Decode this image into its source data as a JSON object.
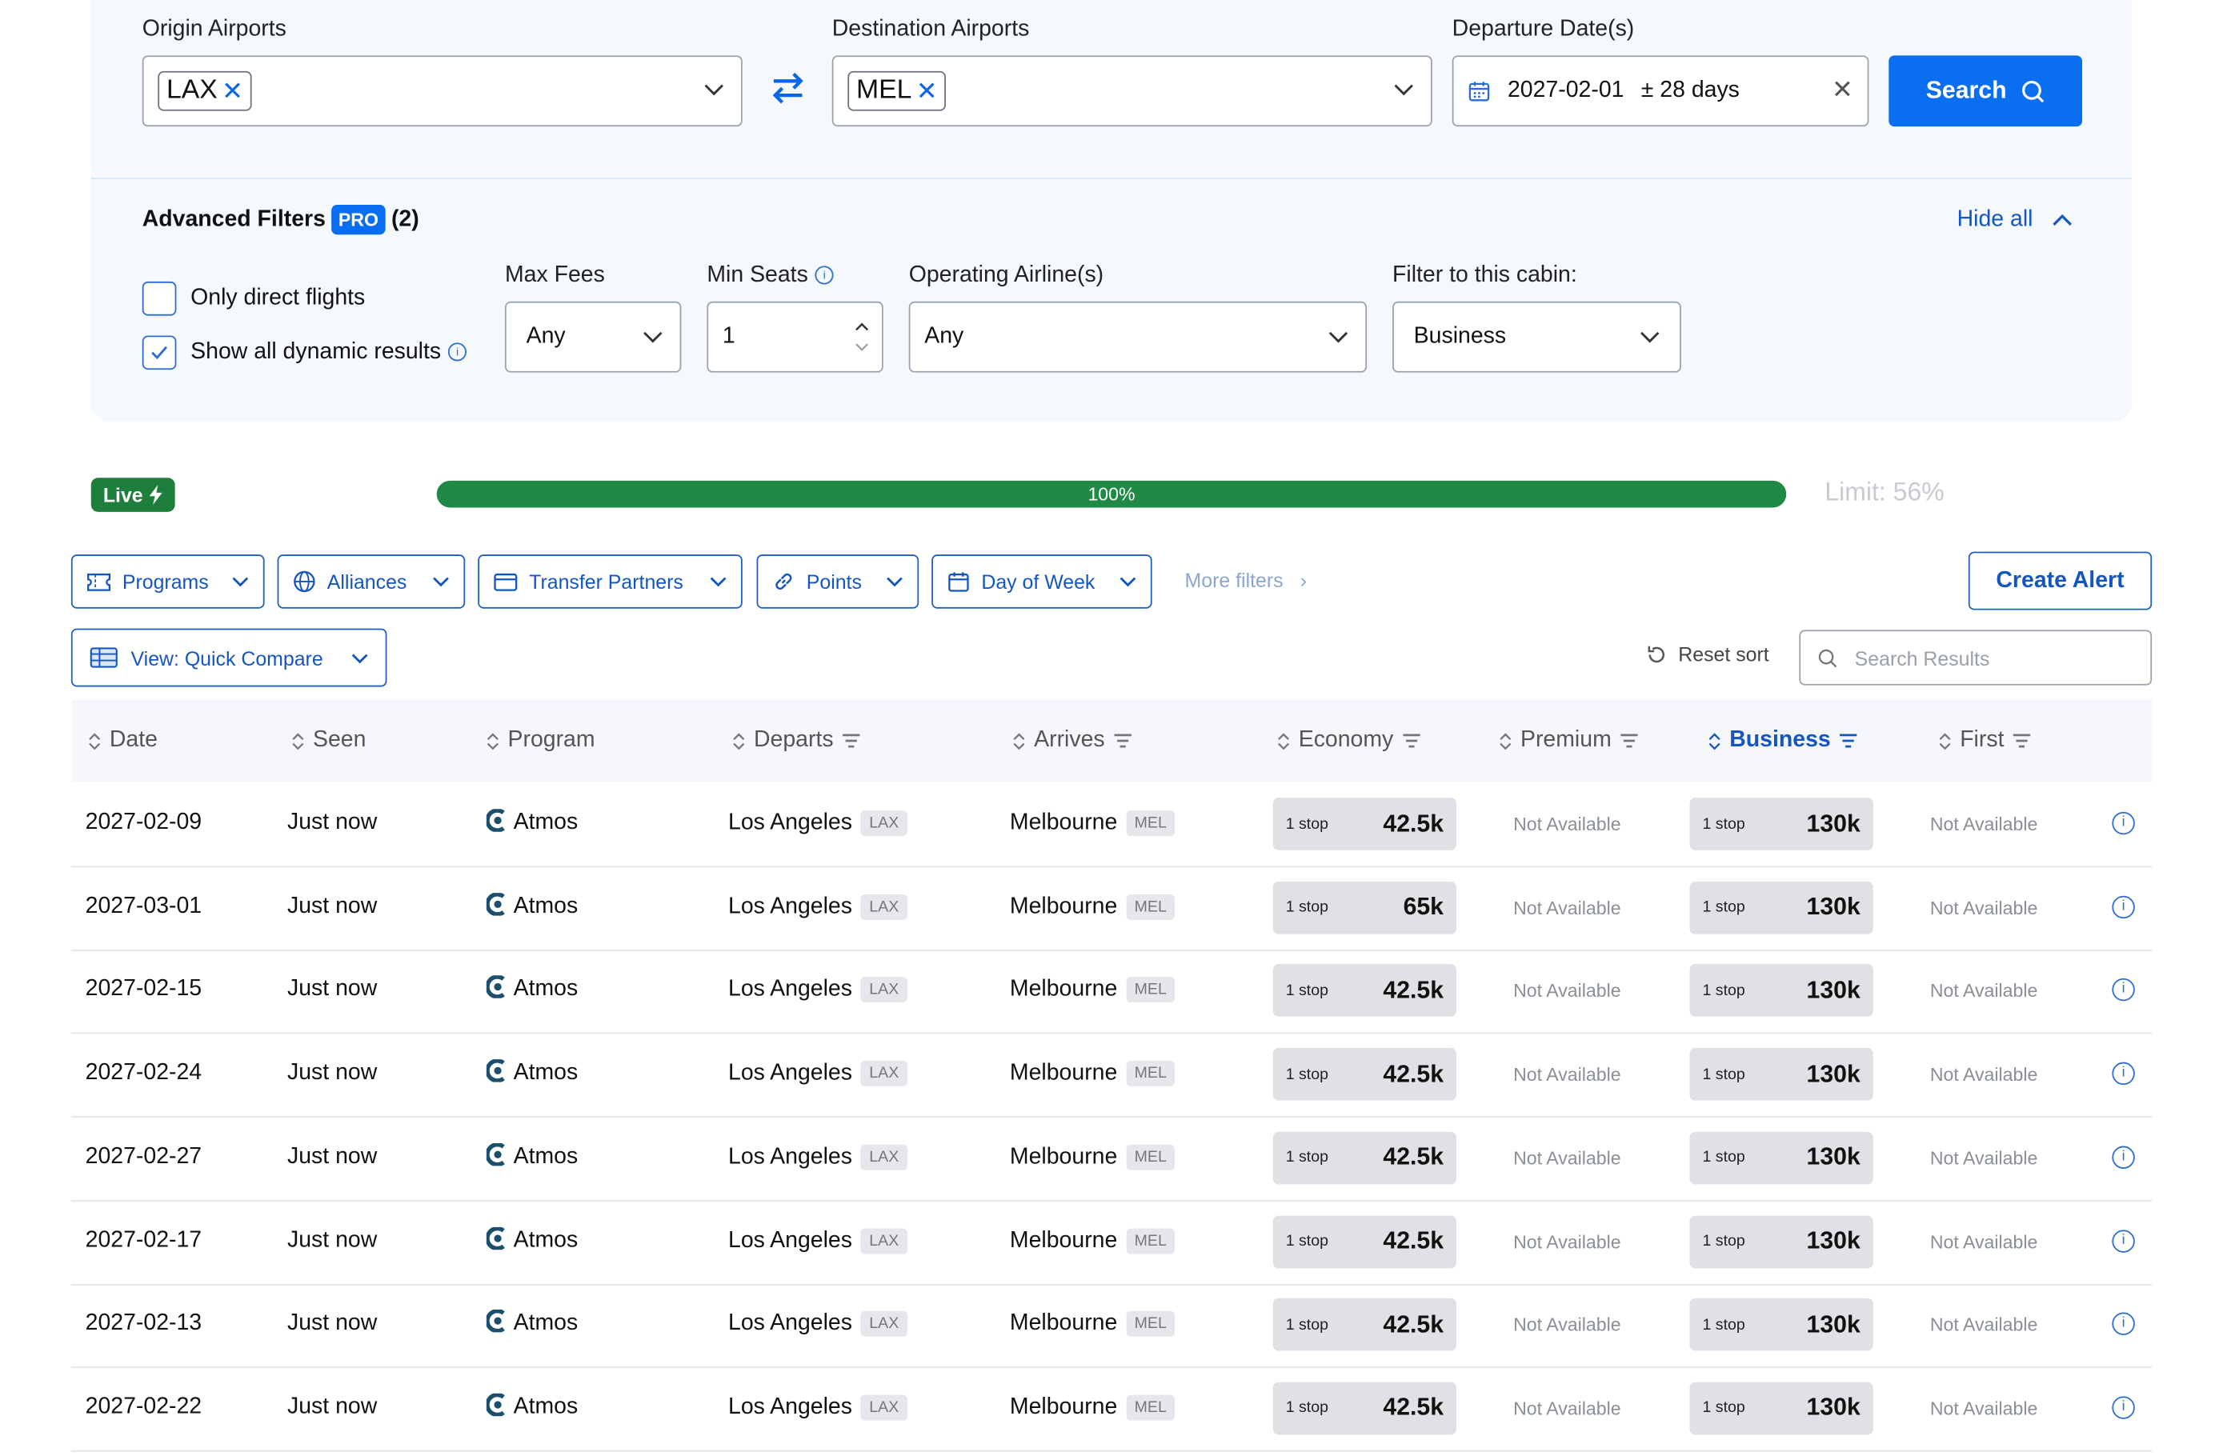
{
  "search": {
    "origin_label": "Origin Airports",
    "origin_chip": "LAX",
    "destination_label": "Destination Airports",
    "destination_chip": "MEL",
    "date_label": "Departure Date(s)",
    "date_value": "2027-02-01",
    "date_range": "± 28 days",
    "search_button": "Search"
  },
  "advanced": {
    "title": "Advanced Filters",
    "pro_badge": "PRO",
    "count": "(2)",
    "hide_all": "Hide all",
    "direct_label": "Only direct flights",
    "dynamic_label": "Show all dynamic results",
    "direct_checked": false,
    "dynamic_checked": true,
    "max_fees_label": "Max Fees",
    "max_fees_value": "Any",
    "min_seats_label": "Min Seats",
    "min_seats_value": "1",
    "airline_label": "Operating Airline(s)",
    "airline_value": "Any",
    "cabin_label": "Filter to this cabin:",
    "cabin_value": "Business"
  },
  "status": {
    "live_label": "Live",
    "progress_text": "100%",
    "progress_fraction": 1.0,
    "limit_text": "Limit: 56%"
  },
  "filters": {
    "programs": "Programs",
    "alliances": "Alliances",
    "transfer_partners": "Transfer Partners",
    "points": "Points",
    "day_of_week": "Day of Week",
    "more_filters": "More filters",
    "create_alert": "Create Alert",
    "view": "View: Quick Compare",
    "reset_sort": "Reset sort",
    "search_placeholder": "Search Results"
  },
  "table": {
    "headers": {
      "date": "Date",
      "seen": "Seen",
      "program": "Program",
      "departs": "Departs",
      "arrives": "Arrives",
      "economy": "Economy",
      "premium": "Premium",
      "business": "Business",
      "first": "First"
    },
    "rows": [
      {
        "date": "2027-02-09",
        "seen": "Just now",
        "program": "Atmos",
        "dep_city": "Los Angeles",
        "dep_code": "LAX",
        "arr_city": "Melbourne",
        "arr_code": "MEL",
        "eco_stops": "1 stop",
        "eco_pts": "42.5k",
        "premium": "Not Available",
        "bus_stops": "1 stop",
        "bus_pts": "130k",
        "first": "Not Available"
      },
      {
        "date": "2027-03-01",
        "seen": "Just now",
        "program": "Atmos",
        "dep_city": "Los Angeles",
        "dep_code": "LAX",
        "arr_city": "Melbourne",
        "arr_code": "MEL",
        "eco_stops": "1 stop",
        "eco_pts": "65k",
        "premium": "Not Available",
        "bus_stops": "1 stop",
        "bus_pts": "130k",
        "first": "Not Available"
      },
      {
        "date": "2027-02-15",
        "seen": "Just now",
        "program": "Atmos",
        "dep_city": "Los Angeles",
        "dep_code": "LAX",
        "arr_city": "Melbourne",
        "arr_code": "MEL",
        "eco_stops": "1 stop",
        "eco_pts": "42.5k",
        "premium": "Not Available",
        "bus_stops": "1 stop",
        "bus_pts": "130k",
        "first": "Not Available"
      },
      {
        "date": "2027-02-24",
        "seen": "Just now",
        "program": "Atmos",
        "dep_city": "Los Angeles",
        "dep_code": "LAX",
        "arr_city": "Melbourne",
        "arr_code": "MEL",
        "eco_stops": "1 stop",
        "eco_pts": "42.5k",
        "premium": "Not Available",
        "bus_stops": "1 stop",
        "bus_pts": "130k",
        "first": "Not Available"
      },
      {
        "date": "2027-02-27",
        "seen": "Just now",
        "program": "Atmos",
        "dep_city": "Los Angeles",
        "dep_code": "LAX",
        "arr_city": "Melbourne",
        "arr_code": "MEL",
        "eco_stops": "1 stop",
        "eco_pts": "42.5k",
        "premium": "Not Available",
        "bus_stops": "1 stop",
        "bus_pts": "130k",
        "first": "Not Available"
      },
      {
        "date": "2027-02-17",
        "seen": "Just now",
        "program": "Atmos",
        "dep_city": "Los Angeles",
        "dep_code": "LAX",
        "arr_city": "Melbourne",
        "arr_code": "MEL",
        "eco_stops": "1 stop",
        "eco_pts": "42.5k",
        "premium": "Not Available",
        "bus_stops": "1 stop",
        "bus_pts": "130k",
        "first": "Not Available"
      },
      {
        "date": "2027-02-13",
        "seen": "Just now",
        "program": "Atmos",
        "dep_city": "Los Angeles",
        "dep_code": "LAX",
        "arr_city": "Melbourne",
        "arr_code": "MEL",
        "eco_stops": "1 stop",
        "eco_pts": "42.5k",
        "premium": "Not Available",
        "bus_stops": "1 stop",
        "bus_pts": "130k",
        "first": "Not Available"
      },
      {
        "date": "2027-02-22",
        "seen": "Just now",
        "program": "Atmos",
        "dep_city": "Los Angeles",
        "dep_code": "LAX",
        "arr_city": "Melbourne",
        "arr_code": "MEL",
        "eco_stops": "1 stop",
        "eco_pts": "42.5k",
        "premium": "Not Available",
        "bus_stops": "1 stop",
        "bus_pts": "130k",
        "first": "Not Available"
      }
    ]
  },
  "colors": {
    "accent": "#0a6ef0",
    "live_green": "#1e7f3d",
    "progress_green": "#1e8a45"
  },
  "icons": [
    "chevron-down-icon",
    "swap-icon",
    "calendar-icon",
    "close-icon",
    "search-icon",
    "chevron-up-icon",
    "info-icon",
    "bolt-icon",
    "ticket-icon",
    "globe-icon",
    "card-icon",
    "link-icon",
    "table-icon",
    "reset-icon",
    "sort-icon",
    "filter-icon",
    "atmos-logo-icon"
  ]
}
